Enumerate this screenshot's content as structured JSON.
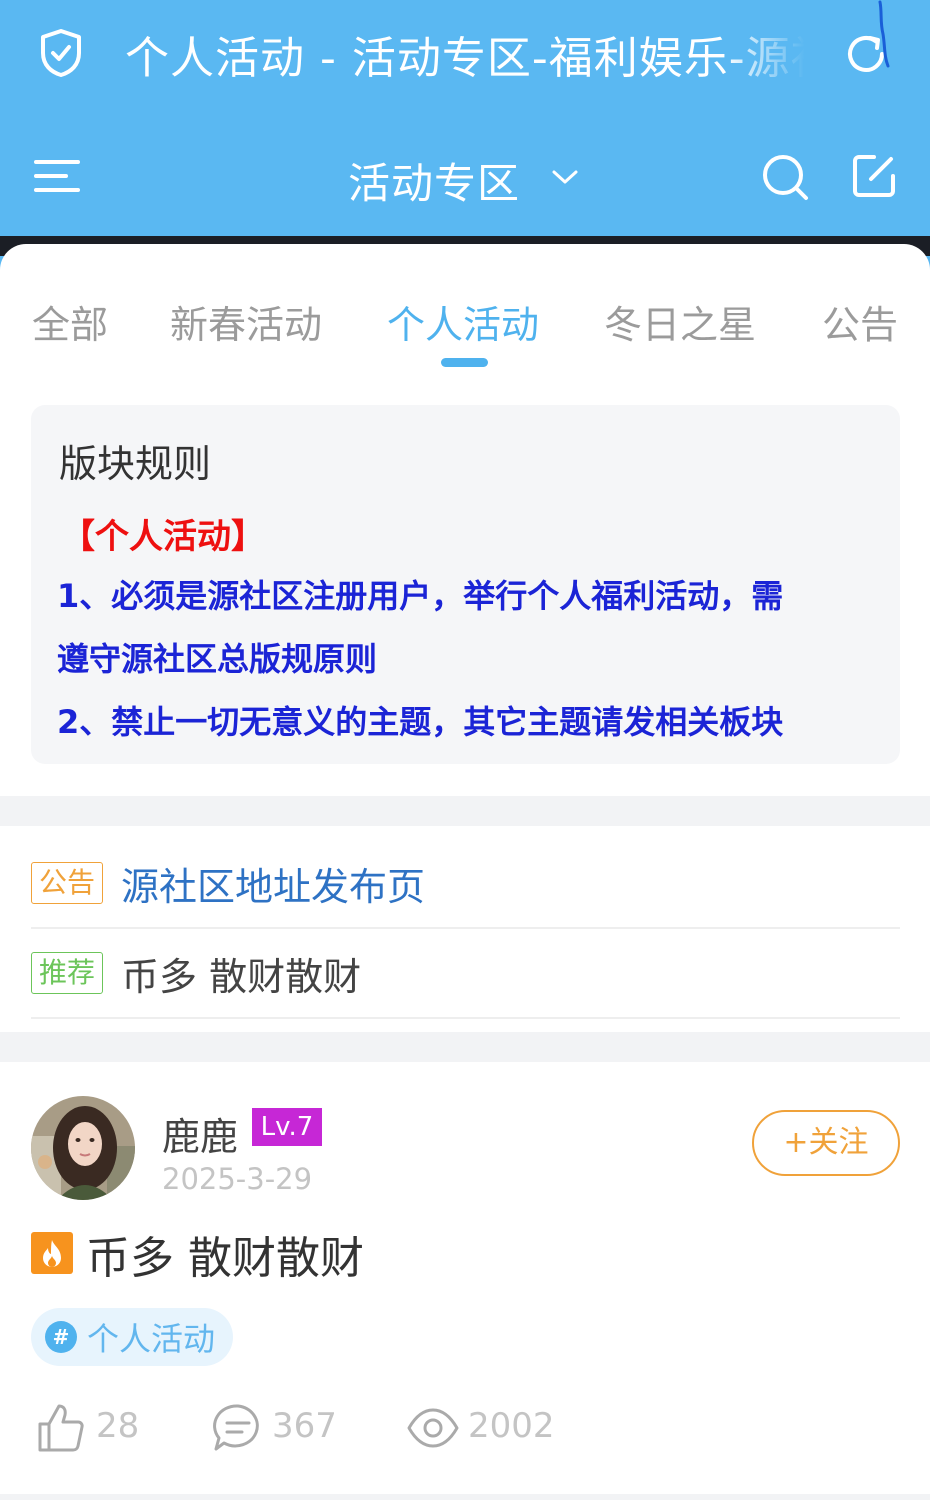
{
  "browser": {
    "title": "个人活动 - 活动专区-福利娱乐-源社区"
  },
  "header": {
    "title": "活动专区"
  },
  "tabs": [
    {
      "label": "全部"
    },
    {
      "label": "新春活动"
    },
    {
      "label": "个人活动"
    },
    {
      "label": "冬日之星"
    },
    {
      "label": "公告"
    }
  ],
  "active_tab": "个人活动",
  "rules": {
    "title": "版块规则",
    "heading": "【个人活动】",
    "lines": [
      "1、必须是源社区注册用户，举行个人福利活动，需",
      "遵守源社区总版规原则",
      "2、禁止一切无意义的主题，其它主题请发相关板块"
    ]
  },
  "notices": [
    {
      "tag": "公告",
      "text": "源社区地址发布页"
    },
    {
      "tag": "推荐",
      "text": "币多 散财散财"
    }
  ],
  "post": {
    "author": "鹿鹿",
    "level": "Lv.7",
    "date": "2025-3-29",
    "follow_label": "+关注",
    "title": "币多 散财散财",
    "topic": "个人活动",
    "likes": "28",
    "comments": "367",
    "views": "2002"
  },
  "colors": {
    "header_blue": "#5ab8f2",
    "accent_blue": "#4fb2ee",
    "rule_red": "#ee1010",
    "rule_blue": "#1b24d6",
    "orange": "#f0a23a",
    "green": "#6cc55a",
    "level_purple": "#c627d6"
  },
  "icons": [
    "shield-check-icon",
    "reload-icon",
    "menu-icon",
    "chevron-down-icon",
    "search-icon",
    "edit-icon",
    "hot-icon",
    "hashtag-icon",
    "thumbs-up-icon",
    "comment-icon",
    "eye-icon"
  ]
}
